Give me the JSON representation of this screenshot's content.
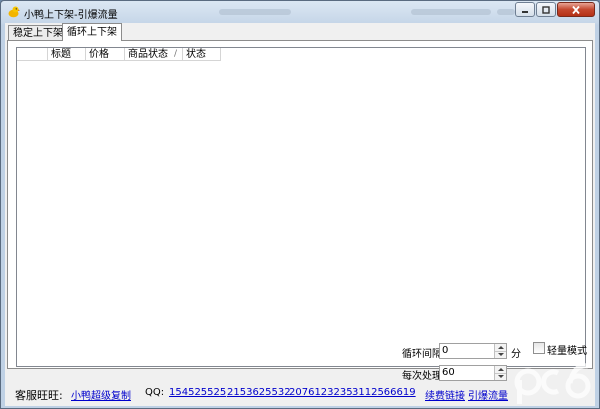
{
  "window": {
    "title": "小鸭上下架-引爆流量",
    "controls": {
      "minimize": "minimize",
      "maximize": "maximize",
      "close": "close"
    }
  },
  "tabs": [
    {
      "label": "稳定上下架",
      "active": false
    },
    {
      "label": "循环上下架",
      "active": true
    }
  ],
  "list": {
    "columns": [
      "",
      "标题",
      "价格",
      "商品状态",
      "状态"
    ],
    "rows": []
  },
  "settings": {
    "loop_interval_label": "循环间隔",
    "loop_interval_value": "0",
    "loop_interval_unit": "分",
    "per_process_label": "每次处理",
    "per_process_value": "60",
    "light_mode_label": "轻量模式",
    "light_mode_checked": false
  },
  "footer": {
    "support_label": "客服旺旺:",
    "support_link": "小鸭超级复制",
    "qq_label": "QQ:",
    "qq_numbers": [
      "154525525",
      "2153625532",
      "2076123235",
      "3112566619"
    ],
    "link_1": "续费链接",
    "link_2": "引爆流量"
  },
  "colors": {
    "link": "#0000cc",
    "title_bar": "#c6d6e8",
    "client_bg": "#f0f0f0",
    "close_button": "#c4482f"
  },
  "icons": {
    "app": "duck-icon"
  }
}
